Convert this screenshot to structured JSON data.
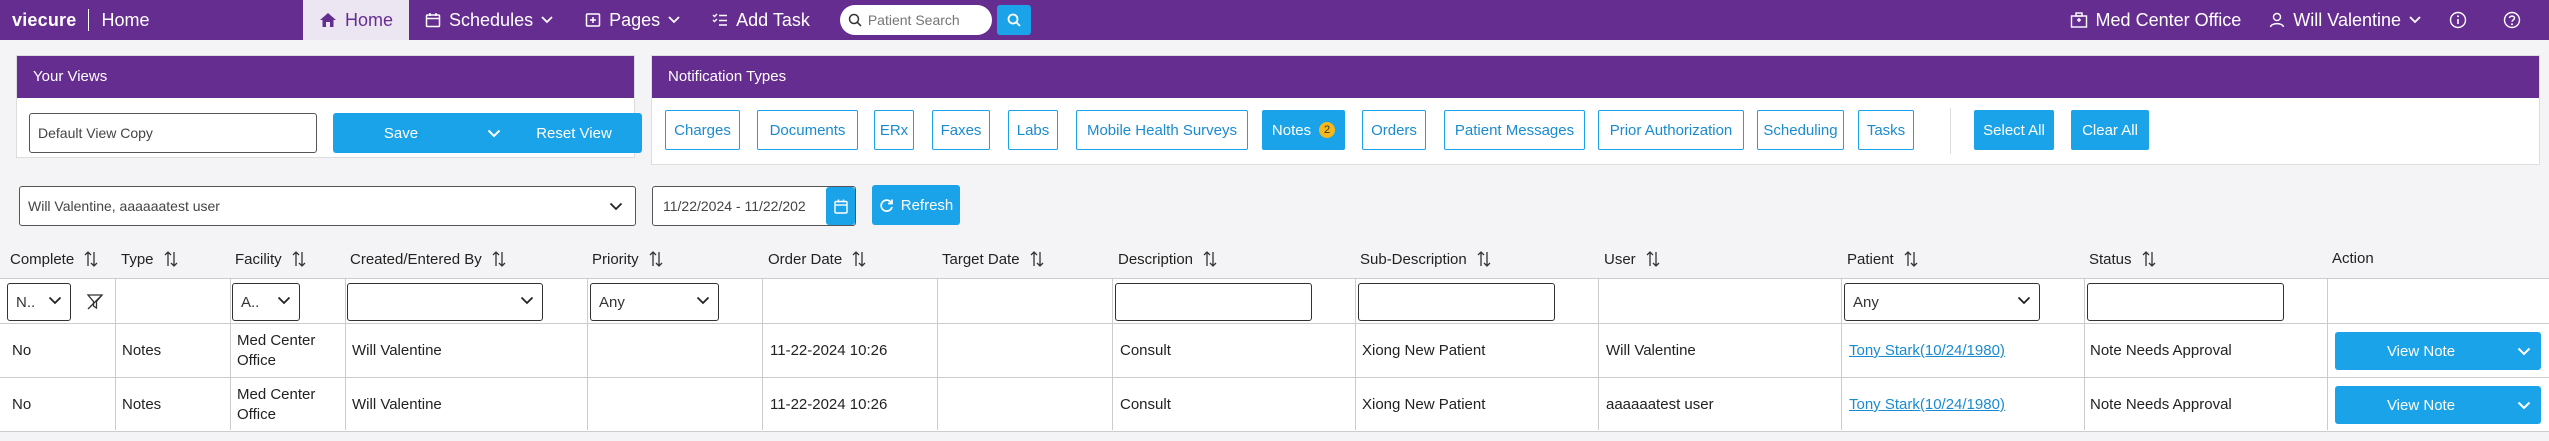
{
  "topbar": {
    "brand": "viecure",
    "section": "Home",
    "nav": [
      {
        "label": "Home"
      },
      {
        "label": "Schedules"
      },
      {
        "label": "Pages"
      },
      {
        "label": "Add Task"
      }
    ],
    "search_placeholder": "Patient Search",
    "office": "Med Center Office",
    "user": "Will Valentine"
  },
  "your_views": {
    "title": "Your Views",
    "view_name": "Default View Copy",
    "save_label": "Save",
    "reset_label": "Reset View"
  },
  "notification_types": {
    "title": "Notification Types",
    "chips": [
      "Charges",
      "Documents",
      "ERx",
      "Faxes",
      "Labs",
      "Mobile Health Surveys",
      "Notes",
      "Orders",
      "Patient Messages",
      "Prior Authorization",
      "Scheduling",
      "Tasks"
    ],
    "notes_count": "2",
    "select_all": "Select All",
    "clear_all": "Clear All"
  },
  "filters": {
    "users": "Will Valentine, aaaaaatest user",
    "date_range": "11/22/2024 - 11/22/202",
    "refresh": "Refresh"
  },
  "table": {
    "columns": [
      "Complete",
      "Type",
      "Facility",
      "Created/Entered By",
      "Priority",
      "Order Date",
      "Target Date",
      "Description",
      "Sub-Description",
      "User",
      "Patient",
      "Status",
      "Action"
    ],
    "filter_values": {
      "complete": "N..",
      "facility": "A..",
      "priority": "Any",
      "patient": "Any"
    },
    "rows": [
      {
        "complete": "No",
        "type": "Notes",
        "facility": "Med Center Office",
        "created_by": "Will Valentine",
        "priority": "",
        "order_date": "11-22-2024 10:26",
        "target_date": "",
        "description": "Consult",
        "sub_description": "Xiong New Patient",
        "user": "Will Valentine",
        "patient": "Tony Stark(10/24/1980)",
        "status": "Note Needs Approval",
        "action": "View Note"
      },
      {
        "complete": "No",
        "type": "Notes",
        "facility": "Med Center Office",
        "created_by": "Will Valentine",
        "priority": "",
        "order_date": "11-22-2024 10:26",
        "target_date": "",
        "description": "Consult",
        "sub_description": "Xiong New Patient",
        "user": "aaaaaatest user",
        "patient": "Tony Stark(10/24/1980)",
        "status": "Note Needs Approval",
        "action": "View Note"
      }
    ]
  },
  "colors": {
    "brand_purple": "#662d91",
    "accent_blue": "#1aa3e8",
    "badge_yellow": "#f5b81c"
  }
}
